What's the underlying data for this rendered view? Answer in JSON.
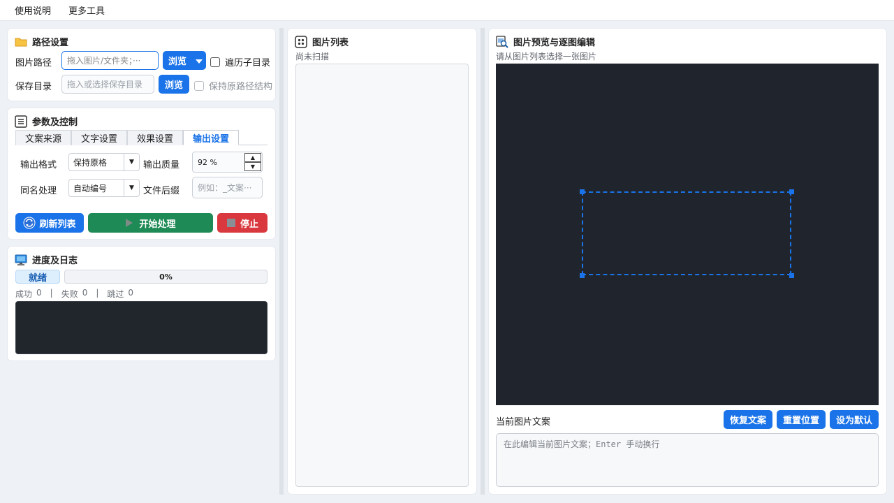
{
  "menu": {
    "usage": "使用说明",
    "more_tools": "更多工具"
  },
  "path_card": {
    "title": "路径设置",
    "image_path_label": "图片路径",
    "image_path_placeholder": "拖入图片/文件夹；···",
    "browse_label": "浏览",
    "recursive_label": "遍历子目录",
    "save_dir_label": "保存目录",
    "save_dir_placeholder": "拖入或选择保存目录",
    "browse2_label": "浏览",
    "keep_structure_label": "保持原路径结构"
  },
  "params_card": {
    "title": "参数及控制",
    "tabs": [
      {
        "label": "文案来源",
        "selected": false
      },
      {
        "label": "文字设置",
        "selected": false
      },
      {
        "label": "效果设置",
        "selected": false
      },
      {
        "label": "输出设置",
        "selected": true
      }
    ],
    "output_format_label": "输出格式",
    "output_format_value": "保持原格",
    "output_quality_label": "输出质量",
    "output_quality_value": "92 %",
    "same_name_label": "同名处理",
    "same_name_value": "自动编号",
    "file_suffix_label": "文件后缀",
    "file_suffix_placeholder": "例如：_文案···",
    "refresh_label": "刷新列表",
    "start_label": "开始处理",
    "stop_label": "停止"
  },
  "progress_card": {
    "title": "进度及日志",
    "status": "就绪",
    "progress_text": "0%",
    "progress_fraction": 0,
    "success_label": "成功",
    "success_count": "0",
    "fail_label": "失败",
    "fail_count": "0",
    "skip_label": "跳过",
    "skip_count": "0",
    "separator": "|"
  },
  "list_card": {
    "title": "图片列表",
    "status": "尚未扫描"
  },
  "preview_card": {
    "title": "图片预览与逐图编辑",
    "hint": "请从图片列表选择一张图片",
    "caption_label": "当前图片文案",
    "restore_label": "恢复文案",
    "reset_pos_label": "重置位置",
    "set_default_label": "设为默认",
    "text_placeholder": "在此编辑当前图片文案；Enter 手动换行"
  },
  "colors": {
    "accent": "#1a73e8",
    "start_green": "#1e8a55",
    "stop_red": "#d9383e",
    "preview_bg": "#20252d"
  },
  "icons": {
    "path": "folder-icon",
    "params": "list-icon",
    "progress": "monitor-icon",
    "list": "grid-icon",
    "preview": "image-search-icon",
    "refresh": "refresh-icon",
    "start": "play-icon",
    "stop": "stop-icon"
  }
}
